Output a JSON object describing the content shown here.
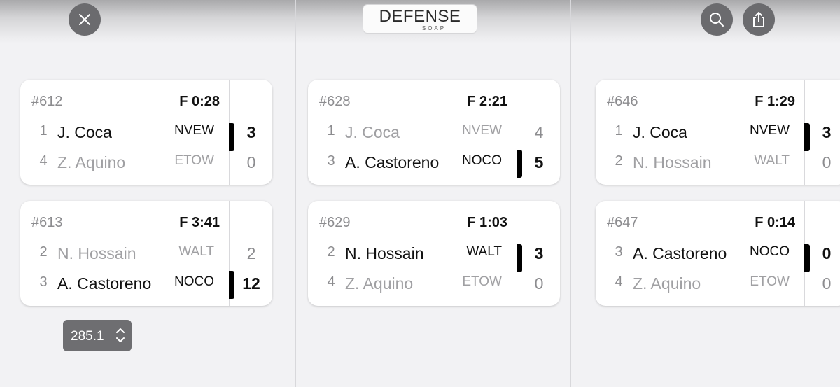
{
  "logo": {
    "text": "DEFENSE",
    "subtext": "SOAP"
  },
  "toolbar": {
    "close_icon": "close-icon",
    "search_icon": "search-icon",
    "share_icon": "share-icon"
  },
  "matches": [
    {
      "number": "#612",
      "status": "F 0:28",
      "players": [
        {
          "seed": "1",
          "name": "J. Coca",
          "team": "NVEW",
          "score": "3",
          "winner": true
        },
        {
          "seed": "4",
          "name": "Z. Aquino",
          "team": "ETOW",
          "score": "0",
          "winner": false
        }
      ]
    },
    {
      "number": "#613",
      "status": "F 3:41",
      "players": [
        {
          "seed": "2",
          "name": "N. Hossain",
          "team": "WALT",
          "score": "2",
          "winner": false
        },
        {
          "seed": "3",
          "name": "A. Castoreno",
          "team": "NOCO",
          "score": "12",
          "winner": true
        }
      ]
    },
    {
      "number": "#628",
      "status": "F 2:21",
      "players": [
        {
          "seed": "1",
          "name": "J. Coca",
          "team": "NVEW",
          "score": "4",
          "winner": false
        },
        {
          "seed": "3",
          "name": "A. Castoreno",
          "team": "NOCO",
          "score": "5",
          "winner": true
        }
      ]
    },
    {
      "number": "#629",
      "status": "F 1:03",
      "players": [
        {
          "seed": "2",
          "name": "N. Hossain",
          "team": "WALT",
          "score": "3",
          "winner": true
        },
        {
          "seed": "4",
          "name": "Z. Aquino",
          "team": "ETOW",
          "score": "0",
          "winner": false
        }
      ]
    },
    {
      "number": "#646",
      "status": "F 1:29",
      "players": [
        {
          "seed": "1",
          "name": "J. Coca",
          "team": "NVEW",
          "score": "3",
          "winner": true
        },
        {
          "seed": "2",
          "name": "N. Hossain",
          "team": "WALT",
          "score": "0",
          "winner": false
        }
      ]
    },
    {
      "number": "#647",
      "status": "F 0:14",
      "players": [
        {
          "seed": "3",
          "name": "A. Castoreno",
          "team": "NOCO",
          "score": "0",
          "winner": true
        },
        {
          "seed": "4",
          "name": "Z. Aquino",
          "team": "ETOW",
          "score": "0",
          "winner": false
        }
      ]
    }
  ],
  "stepper": {
    "value": "285.1",
    "icon": "chevron-up-down-icon"
  }
}
